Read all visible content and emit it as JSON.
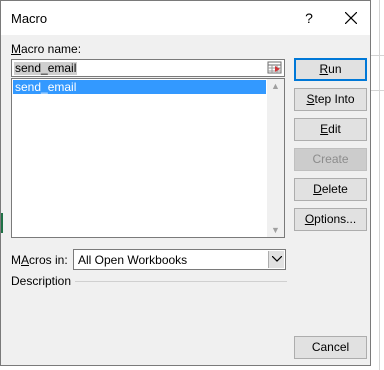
{
  "window": {
    "title": "Macro",
    "help_label": "?"
  },
  "macro_name": {
    "label_underlined": "M",
    "label_rest": "acro name:",
    "value": "send_email"
  },
  "macro_list": {
    "items": [
      "send_email"
    ]
  },
  "buttons": {
    "run": {
      "underlined": "R",
      "rest": "un"
    },
    "step_into": {
      "underlined": "S",
      "rest": "tep Into"
    },
    "edit": {
      "underlined": "E",
      "rest": "dit"
    },
    "create": {
      "underlined": "",
      "rest": "Create"
    },
    "delete": {
      "underlined": "D",
      "rest": "elete"
    },
    "options": {
      "underlined": "O",
      "rest": "ptions..."
    },
    "cancel": {
      "label": "Cancel"
    }
  },
  "macros_in": {
    "label_underlined": "A",
    "label_prefix": "M",
    "label_rest": "cros in:",
    "value": "All Open Workbooks"
  },
  "description": {
    "label": "Description"
  },
  "colors": {
    "selection": "#3399ff",
    "default_border": "#0078d7"
  }
}
